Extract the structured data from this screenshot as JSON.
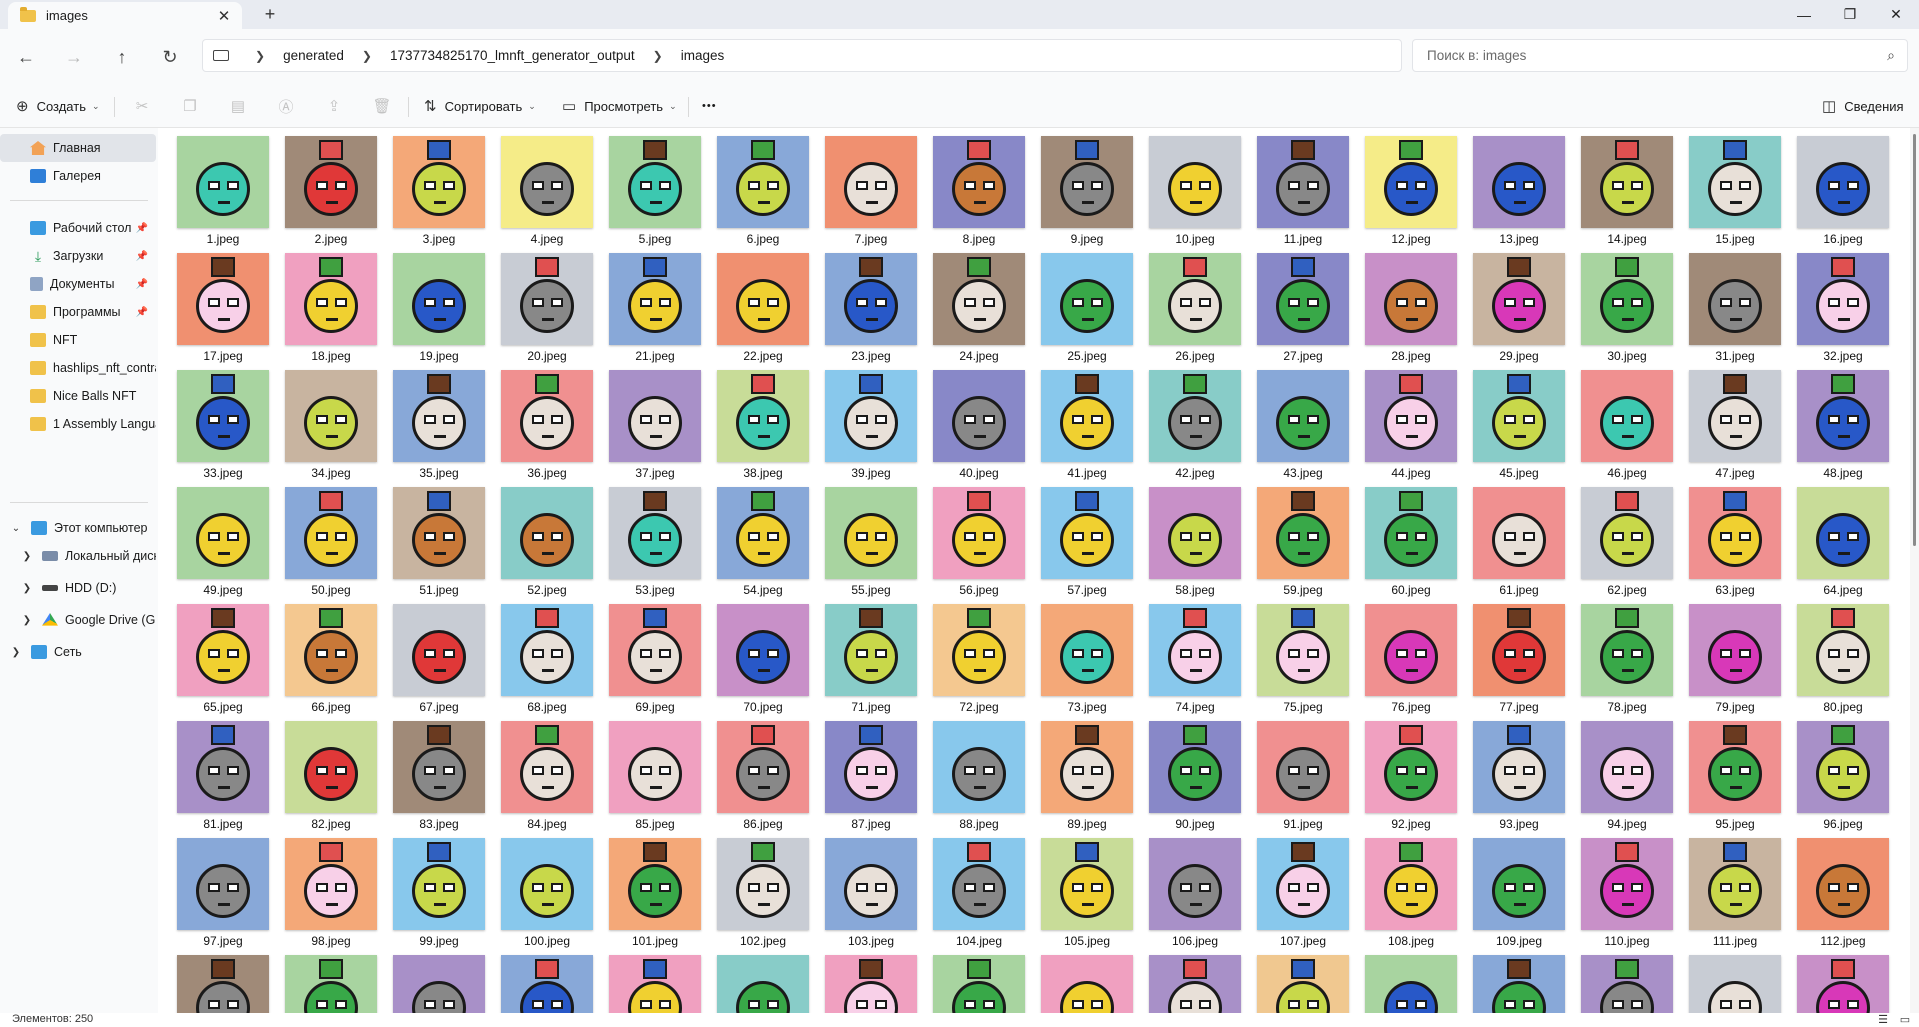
{
  "window": {
    "tab_title": "images",
    "new_tab_label": "+",
    "close_tab_label": "✕",
    "minimize_label": "—",
    "maximize_label": "❐",
    "close_label": "✕"
  },
  "address": {
    "breadcrumbs": [
      "generated",
      "1737734825170_lmnft_generator_output",
      "images"
    ],
    "search_placeholder": "Поиск в: images"
  },
  "toolbar": {
    "create_label": "Создать",
    "sort_label": "Сортировать",
    "view_label": "Просмотреть",
    "more_label": "•••",
    "details_label": "Сведения"
  },
  "sidebar": {
    "items": [
      {
        "label": "Главная",
        "icon": "home-icon",
        "active": true
      },
      {
        "label": "Галерея",
        "icon": "gallery-icon"
      },
      {
        "label": "Рабочий стол",
        "icon": "desktop-icon",
        "pinned": true
      },
      {
        "label": "Загрузки",
        "icon": "download-icon",
        "pinned": true
      },
      {
        "label": "Документы",
        "icon": "documents-icon",
        "pinned": true
      },
      {
        "label": "Программы",
        "icon": "folder-icon",
        "pinned": true
      },
      {
        "label": "NFT",
        "icon": "folder-icon"
      },
      {
        "label": "hashlips_nft_contra",
        "icon": "folder-icon"
      },
      {
        "label": "Nice Balls NFT",
        "icon": "folder-icon"
      },
      {
        "label": "1 Assembly Langua",
        "icon": "folder-icon"
      },
      {
        "label": "Этот компьютер",
        "icon": "computer-icon"
      },
      {
        "label": "Локальный диск",
        "icon": "drive-icon"
      },
      {
        "label": "HDD (D:)",
        "icon": "hdd-icon"
      },
      {
        "label": "Google Drive (G:)",
        "icon": "google-drive-icon"
      },
      {
        "label": "Сеть",
        "icon": "network-icon"
      }
    ]
  },
  "status": {
    "count_label": "Элементов: 250"
  },
  "files": {
    "labels": [
      "1.jpeg",
      "2.jpeg",
      "3.jpeg",
      "4.jpeg",
      "5.jpeg",
      "6.jpeg",
      "7.jpeg",
      "8.jpeg",
      "9.jpeg",
      "10.jpeg",
      "11.jpeg",
      "12.jpeg",
      "13.jpeg",
      "14.jpeg",
      "15.jpeg",
      "16.jpeg",
      "17.jpeg",
      "18.jpeg",
      "19.jpeg",
      "20.jpeg",
      "21.jpeg",
      "22.jpeg",
      "23.jpeg",
      "24.jpeg",
      "25.jpeg",
      "26.jpeg",
      "27.jpeg",
      "28.jpeg",
      "29.jpeg",
      "30.jpeg",
      "31.jpeg",
      "32.jpeg",
      "33.jpeg",
      "34.jpeg",
      "35.jpeg",
      "36.jpeg",
      "37.jpeg",
      "38.jpeg",
      "39.jpeg",
      "40.jpeg",
      "41.jpeg",
      "42.jpeg",
      "43.jpeg",
      "44.jpeg",
      "45.jpeg",
      "46.jpeg",
      "47.jpeg",
      "48.jpeg",
      "49.jpeg",
      "50.jpeg",
      "51.jpeg",
      "52.jpeg",
      "53.jpeg",
      "54.jpeg",
      "55.jpeg",
      "56.jpeg",
      "57.jpeg",
      "58.jpeg",
      "59.jpeg",
      "60.jpeg",
      "61.jpeg",
      "62.jpeg",
      "63.jpeg",
      "64.jpeg",
      "65.jpeg",
      "66.jpeg",
      "67.jpeg",
      "68.jpeg",
      "69.jpeg",
      "70.jpeg",
      "71.jpeg",
      "72.jpeg",
      "73.jpeg",
      "74.jpeg",
      "75.jpeg",
      "76.jpeg",
      "77.jpeg",
      "78.jpeg",
      "79.jpeg",
      "80.jpeg",
      "81.jpeg",
      "82.jpeg",
      "83.jpeg",
      "84.jpeg",
      "85.jpeg",
      "86.jpeg",
      "87.jpeg",
      "88.jpeg",
      "89.jpeg",
      "90.jpeg",
      "91.jpeg",
      "92.jpeg",
      "93.jpeg",
      "94.jpeg",
      "95.jpeg",
      "96.jpeg",
      "97.jpeg",
      "98.jpeg",
      "99.jpeg",
      "100.jpeg",
      "101.jpeg",
      "102.jpeg",
      "103.jpeg",
      "104.jpeg",
      "105.jpeg",
      "106.jpeg",
      "107.jpeg",
      "108.jpeg",
      "109.jpeg",
      "110.jpeg",
      "111.jpeg",
      "112.jpeg",
      "",
      "",
      "",
      "",
      "",
      "",
      "",
      "",
      "",
      "",
      "",
      "",
      "",
      "",
      "",
      ""
    ],
    "bg_colors": [
      "#a8d4a0",
      "#a08a78",
      "#f4a878",
      "#f5ec88",
      "#a8d4a0",
      "#88a8d8",
      "#f09070",
      "#8888c8",
      "#a08a78",
      "#c8ccd4",
      "#8888c8",
      "#f5ec88",
      "#a890c8",
      "#a08a78",
      "#88ccc8",
      "#c8ccd4",
      "#f09070",
      "#f0a0c0",
      "#a8d4a0",
      "#c8ccd4",
      "#88a8d8",
      "#f09070",
      "#88a8d8",
      "#a08a78",
      "#88c8ec",
      "#a8d4a0",
      "#8888c8",
      "#c890c8",
      "#c8b4a0",
      "#a8d4a0",
      "#a08a78",
      "#8888c8",
      "#a8d4a0",
      "#c8b4a0",
      "#88a8d8",
      "#f09090",
      "#a890c8",
      "#c8dc98",
      "#88c8ec",
      "#8888c8",
      "#88c8ec",
      "#88ccc8",
      "#88a8d8",
      "#a890c8",
      "#88ccc8",
      "#f09090",
      "#c8ccd4",
      "#a890c8",
      "#a8d4a0",
      "#88a8d8",
      "#c8b4a0",
      "#88ccc8",
      "#c8ccd4",
      "#88a8d8",
      "#a8d4a0",
      "#f0a0c0",
      "#88c8ec",
      "#c890c8",
      "#f4a878",
      "#88ccc8",
      "#f09090",
      "#c8ccd4",
      "#f09090",
      "#c8dc98",
      "#f0a0c0",
      "#f4c890",
      "#c8ccd4",
      "#88c8ec",
      "#f09090",
      "#c890c8",
      "#88ccc8",
      "#f4c890",
      "#f4a878",
      "#88c8ec",
      "#c8dc98",
      "#f09090",
      "#f09070",
      "#a8d4a0",
      "#c890c8",
      "#c8dc98",
      "#a890c8",
      "#c8dc98",
      "#a08a78",
      "#f09090",
      "#f0a0c0",
      "#f09090",
      "#8888c8",
      "#88c8ec",
      "#f4a878",
      "#8888c8",
      "#f09090",
      "#f0a0c0",
      "#88a8d8",
      "#a890c8",
      "#f09090",
      "#a890c8",
      "#88a8d8",
      "#f4a878",
      "#88c8ec",
      "#88c8ec",
      "#f4a878",
      "#c8ccd4",
      "#88a8d8",
      "#88c8ec",
      "#c8dc98",
      "#a890c8",
      "#88c8ec",
      "#f0a0c0",
      "#88a8d8",
      "#c890c8",
      "#c8b4a0",
      "#f09070",
      "#a08a78",
      "#a8d4a0",
      "#a890c8",
      "#88a8d8",
      "#f0a0c0",
      "#88ccc8",
      "#f0a0c0",
      "#a8d4a0",
      "#f0a0c0",
      "#a890c8",
      "#f0c890",
      "#a8d4a0",
      "#88a8d8",
      "#a890c8",
      "#c8ccd4",
      "#c890c8"
    ],
    "face_colors": [
      "#3cc8b0",
      "#e03838",
      "#c8d84a",
      "#888888",
      "#3cc8b0",
      "#c8d84a",
      "#e8e0d8",
      "#c87838",
      "#888888",
      "#f0d030",
      "#888888",
      "#2858c8",
      "#2858c8",
      "#c8d84a",
      "#e8e0d8",
      "#2858c8",
      "#f8d0e8",
      "#f0d030",
      "#2858c8",
      "#888888",
      "#f0d030",
      "#f0d030",
      "#2858c8",
      "#e8e0d8",
      "#38a848",
      "#e8e0d8",
      "#38a848",
      "#c87838",
      "#d838b8",
      "#38a848",
      "#888888",
      "#f8d0e8",
      "#2858c8",
      "#c8d84a",
      "#e8e0d8",
      "#e8e0d8",
      "#e8e0d8",
      "#3cc8b0",
      "#e8e0d8",
      "#888888",
      "#f0d030",
      "#888888",
      "#38a848",
      "#f8d0e8",
      "#c8d84a",
      "#3cc8b0",
      "#e8e0d8",
      "#2858c8",
      "#f0d030",
      "#f0d030",
      "#c87838",
      "#c87838",
      "#3cc8b0",
      "#f0d030",
      "#f0d030",
      "#f0d030",
      "#f0d030",
      "#c8d84a",
      "#38a848",
      "#38a848",
      "#e8e0d8",
      "#c8d84a",
      "#f0d030",
      "#2858c8",
      "#f0d030",
      "#c87838",
      "#e03838",
      "#e8e0d8",
      "#e8e0d8",
      "#2858c8",
      "#c8d84a",
      "#f0d030",
      "#3cc8b0",
      "#f8d0e8",
      "#f8d0e8",
      "#d838b8",
      "#e03838",
      "#38a848",
      "#d838b8",
      "#e8e0d8",
      "#888888",
      "#e03838",
      "#888888",
      "#e8e0d8",
      "#e8e0d8",
      "#888888",
      "#f8d0e8",
      "#888888",
      "#e8e0d8",
      "#38a848",
      "#888888",
      "#38a848",
      "#e8e0d8",
      "#f8d0e8",
      "#38a848",
      "#c8d84a",
      "#888888",
      "#f8d0e8",
      "#c8d84a",
      "#c8d84a",
      "#38a848",
      "#e8e0d8",
      "#e8e0d8",
      "#888888",
      "#f0d030",
      "#888888",
      "#f8d0e8",
      "#f0d030",
      "#38a848",
      "#d838b8",
      "#c8d84a",
      "#c87838",
      "#888888",
      "#38a848",
      "#888888",
      "#2858c8",
      "#f0d030",
      "#38a848",
      "#f8d0e8",
      "#38a848",
      "#f0d030",
      "#e8e0d8",
      "#c8d84a",
      "#2858c8",
      "#38a848",
      "#888888",
      "#e8e0d8",
      "#d838b8"
    ]
  }
}
